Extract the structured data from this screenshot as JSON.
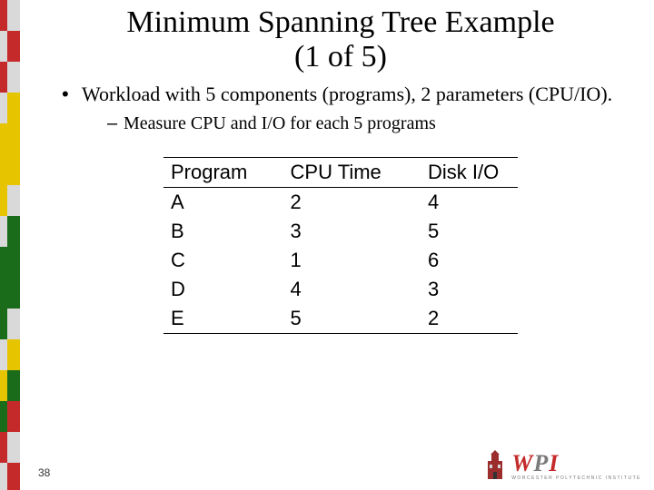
{
  "title_line1": "Minimum Spanning Tree Example",
  "title_line2": "(1 of 5)",
  "bullet": "Workload with 5 components (programs), 2 parameters (CPU/IO).",
  "subbullet": "Measure CPU and I/O for each 5 programs",
  "table": {
    "headers": {
      "c0": "Program",
      "c1": "CPU Time",
      "c2": "Disk I/O"
    },
    "rows": [
      {
        "prog": "A",
        "cpu": "2",
        "io": "4"
      },
      {
        "prog": "B",
        "cpu": "3",
        "io": "5"
      },
      {
        "prog": "C",
        "cpu": "1",
        "io": "6"
      },
      {
        "prog": "D",
        "cpu": "4",
        "io": "3"
      },
      {
        "prog": "E",
        "cpu": "5",
        "io": "2"
      }
    ]
  },
  "page_number": "38",
  "logo": {
    "w": "W",
    "p": "P",
    "i": "I",
    "inst": "WORCESTER POLYTECHNIC INSTITUTE"
  },
  "chart_data": {
    "type": "table",
    "title": "Minimum Spanning Tree Example (1 of 5)",
    "columns": [
      "Program",
      "CPU Time",
      "Disk I/O"
    ],
    "rows": [
      [
        "A",
        2,
        4
      ],
      [
        "B",
        3,
        5
      ],
      [
        "C",
        1,
        6
      ],
      [
        "D",
        4,
        3
      ],
      [
        "E",
        5,
        2
      ]
    ]
  }
}
